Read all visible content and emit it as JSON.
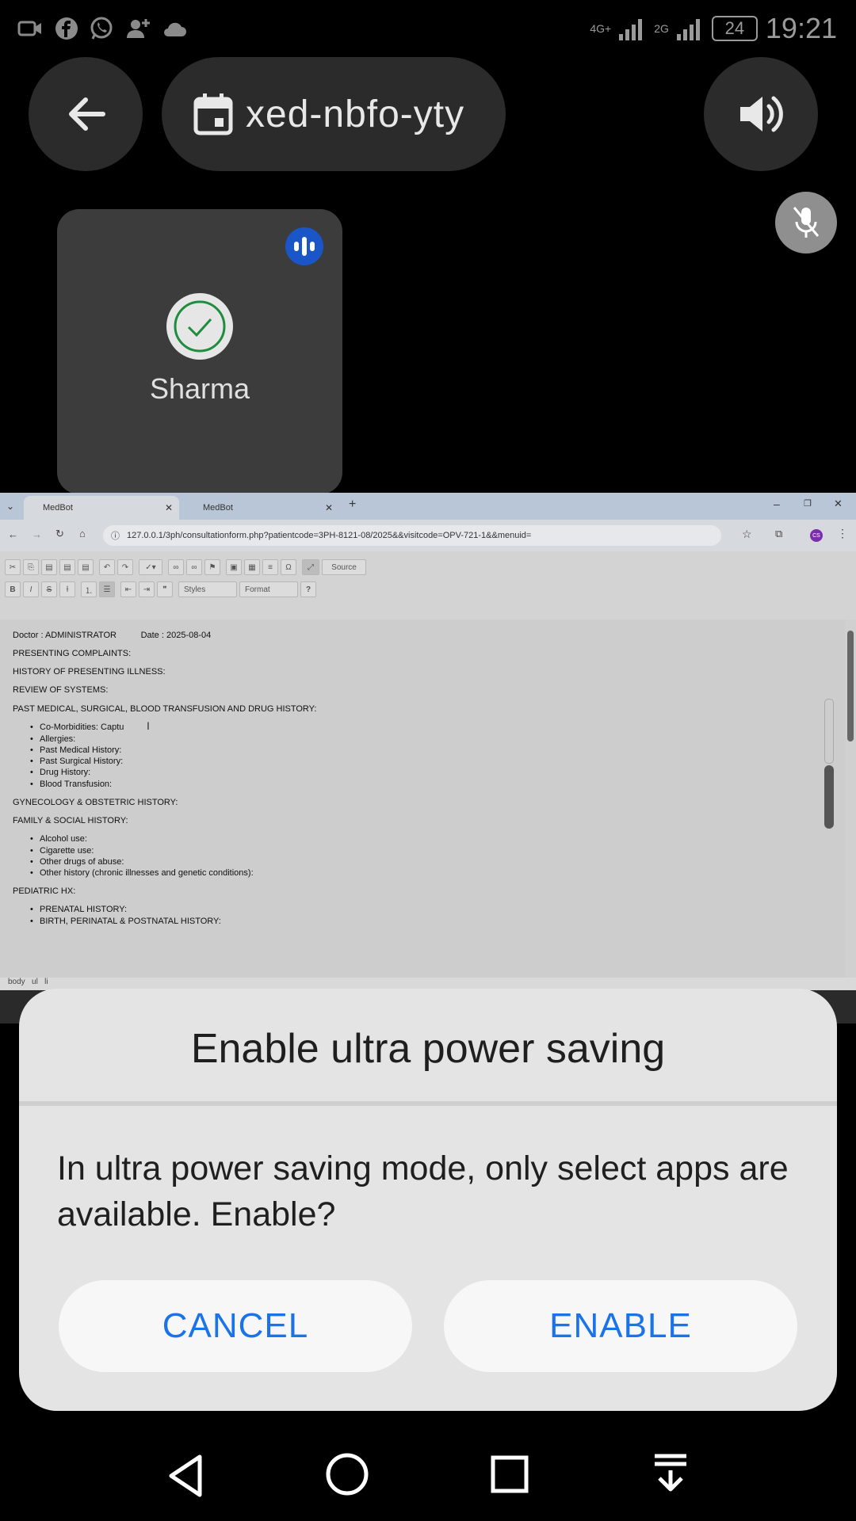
{
  "status_bar": {
    "network_1": "4G+",
    "network_2": "2G",
    "battery": "24",
    "time": "19:21"
  },
  "meet": {
    "meeting_code": "xed-nbfo-yty",
    "participant_name": "Sharma"
  },
  "browser": {
    "tabs": [
      {
        "label": "MedBot"
      },
      {
        "label": "MedBot"
      }
    ],
    "url": "127.0.0.1/3ph/consultationform.php?patientcode=3PH-8121-08/2025&&visitcode=OPV-721-1&&menuid=",
    "toolbar": {
      "source_label": "Source",
      "styles_label": "Styles",
      "format_label": "Format"
    },
    "editor": {
      "header_line": "Doctor : ADMINISTRATOR          Date : 2025-08-04",
      "presenting": "PRESENTING COMPLAINTS:",
      "hpi": "HISTORY OF PRESENTING ILLNESS:",
      "ros": "REVIEW OF SYSTEMS:",
      "past_history": "PAST MEDICAL, SURGICAL, BLOOD TRANSFUSION AND DRUG HISTORY:",
      "past_items": [
        "Co-Morbidities:  Captu",
        "Allergies:",
        "Past Medical History:",
        "Past Surgical History:",
        "Drug History:",
        "Blood Transfusion:"
      ],
      "gyn": "GYNECOLOGY & OBSTETRIC HISTORY:",
      "family": "FAMILY & SOCIAL HISTORY:",
      "family_items": [
        "Alcohol use:",
        "Cigarette use:",
        "Other drugs of abuse:",
        "Other history (chronic illnesses and genetic conditions):"
      ],
      "pediatric": "PEDIATRIC HX:",
      "pediatric_items": [
        "PRENATAL HISTORY:",
        "BIRTH, PERINATAL & POSTNATAL HISTORY:"
      ]
    },
    "status_path": "body   ul   li"
  },
  "dialog": {
    "title": "Enable ultra power saving",
    "message": "In ultra power saving mode, only select apps are available. Enable?",
    "cancel_label": "CANCEL",
    "enable_label": "ENABLE"
  },
  "colors": {
    "accent": "#1a73e8",
    "dialog_bg": "#e4e4e4",
    "tile_bg": "#3c3c3c"
  }
}
